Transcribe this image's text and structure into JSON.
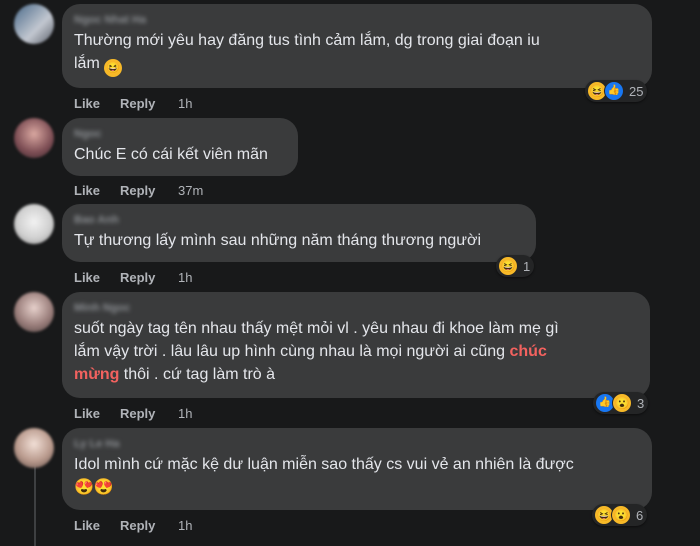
{
  "comments": [
    {
      "author": "Ngoc Nhat Ha",
      "lines": [
        "Thường mới yêu hay đăng tus tình cảm lắm, dg trong giai đoạn iu",
        "lắm"
      ],
      "trailing_emoji": "🤣",
      "actions": {
        "like": "Like",
        "reply": "Reply",
        "time": "1h"
      },
      "reactions": {
        "types": [
          "haha",
          "like"
        ],
        "count": "25"
      }
    },
    {
      "author": "Ngoc",
      "lines": [
        "Chúc E có cái kết viên mãn"
      ],
      "actions": {
        "like": "Like",
        "reply": "Reply",
        "time": "37m"
      }
    },
    {
      "author": "Bao Anh",
      "lines": [
        "Tự thương lấy mình sau những năm tháng thương người"
      ],
      "actions": {
        "like": "Like",
        "reply": "Reply",
        "time": "1h"
      },
      "reactions": {
        "types": [
          "haha"
        ],
        "count": "1"
      }
    },
    {
      "author": "Minh Ngoc",
      "text_parts": {
        "p1": "suốt ngày tag tên nhau thấy mệt mỏi vl . yêu nhau đi khoe làm mẹ gì",
        "p2": "lắm vậy trời . lâu lâu up hình cùng nhau là mọi người ai cũng ",
        "highlight_a": "chúc",
        "highlight_b": "mừng",
        "p3": " thôi . cứ tag làm trò à"
      },
      "actions": {
        "like": "Like",
        "reply": "Reply",
        "time": "1h"
      },
      "reactions": {
        "types": [
          "like",
          "wow"
        ],
        "count": "3"
      }
    },
    {
      "author": "Ly Le Ha",
      "lines": [
        "Idol mình cứ mặc kệ dư luận miễn sao thấy cs vui vẻ an nhiên là được"
      ],
      "emojis": "😍😍",
      "actions": {
        "like": "Like",
        "reply": "Reply",
        "time": "1h"
      },
      "reactions": {
        "types": [
          "haha",
          "wow"
        ],
        "count": "6"
      }
    }
  ],
  "colors": {
    "background": "#18191a",
    "bubble": "#3a3b3c",
    "highlight": "#f3625f",
    "like_blue": "#1877f2",
    "emoji_yellow": "#f7b928"
  },
  "icons": {
    "haha": "haha-reaction-icon",
    "like": "like-reaction-icon",
    "wow": "wow-reaction-icon",
    "love_eyes": "heart-eyes-emoji-icon"
  }
}
